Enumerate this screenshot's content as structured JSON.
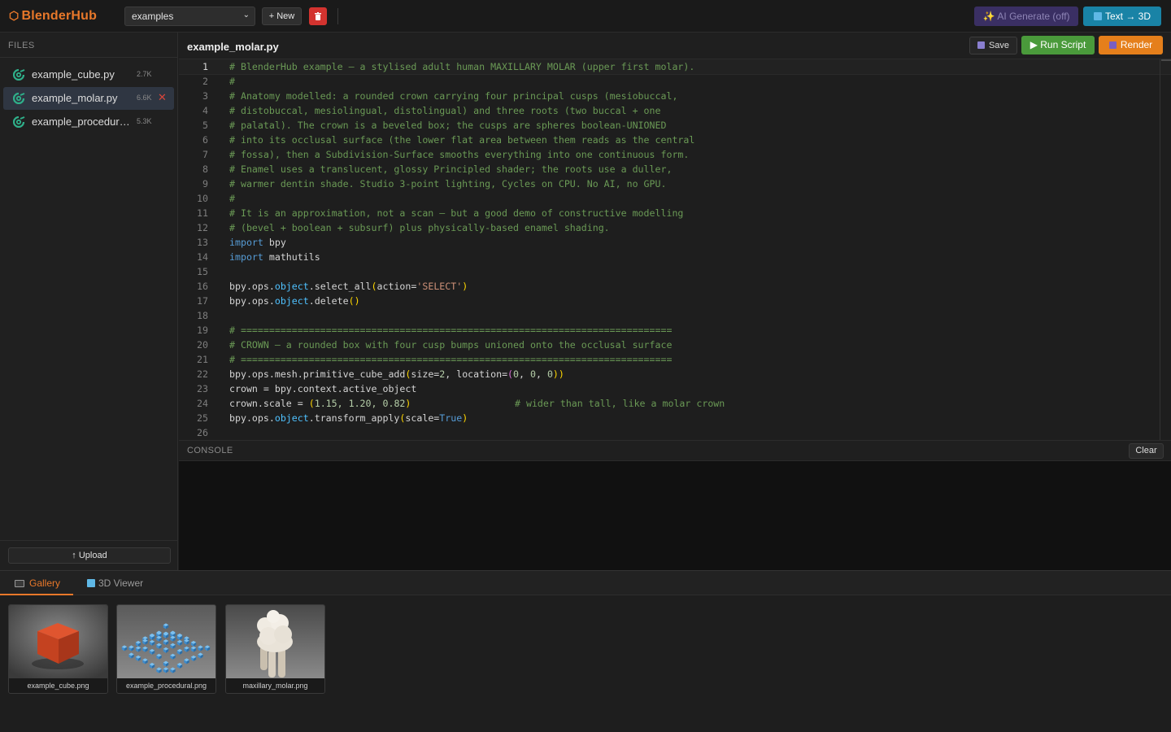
{
  "app": {
    "name": "BlenderHub",
    "project_select": "examples",
    "new_label": "+ New",
    "ai_generate_label": "AI Generate (off)",
    "text3d_label": "Text → 3D"
  },
  "sidebar": {
    "header": "FILES",
    "files": [
      {
        "name": "example_cube.py",
        "size": "2.7K"
      },
      {
        "name": "example_molar.py",
        "size": "6.6K"
      },
      {
        "name": "example_procedural.py",
        "size": "5.3K"
      }
    ],
    "upload_label": "↑ Upload"
  },
  "editor": {
    "filename": "example_molar.py",
    "save_label": "Save",
    "run_label": "▶ Run Script",
    "render_label": "Render",
    "line_numbers": [
      "1",
      "2",
      "3",
      "4",
      "5",
      "6",
      "7",
      "8",
      "9",
      "10",
      "11",
      "12",
      "13",
      "14",
      "15",
      "16",
      "17",
      "18",
      "19",
      "20",
      "21",
      "22",
      "23",
      "24",
      "25",
      "26"
    ],
    "code": {
      "l1": "# BlenderHub example — a stylised adult human MAXILLARY MOLAR (upper first molar).",
      "l2": "#",
      "l3": "# Anatomy modelled: a rounded crown carrying four principal cusps (mesiobuccal,",
      "l4": "# distobuccal, mesiolingual, distolingual) and three roots (two buccal + one",
      "l5": "# palatal). The crown is a beveled box; the cusps are spheres boolean-UNIONED",
      "l6": "# into its occlusal surface (the lower flat area between them reads as the central",
      "l7": "# fossa), then a Subdivision-Surface smooths everything into one continuous form.",
      "l8": "# Enamel uses a translucent, glossy Principled shader; the roots use a duller,",
      "l9": "# warmer dentin shade. Studio 3-point lighting, Cycles on CPU. No AI, no GPU.",
      "l10": "#",
      "l11": "# It is an approximation, not a scan — but a good demo of constructive modelling",
      "l12": "# (bevel + boolean + subsurf) plus physically-based enamel shading.",
      "l13_kw": "import",
      "l13": " bpy",
      "l14_kw": "import",
      "l14": " mathutils",
      "l16_a": "bpy.ops.",
      "l16_obj": "object",
      "l16_b": ".select_all",
      "l16_p1": "(",
      "l16_c": "action=",
      "l16_str": "'SELECT'",
      "l16_p2": ")",
      "l17_a": "bpy.ops.",
      "l17_obj": "object",
      "l17_b": ".delete",
      "l17_p": "()",
      "l19": "# ============================================================================",
      "l20": "# CROWN — a rounded box with four cusp bumps unioned onto the occlusal surface",
      "l21": "# ============================================================================",
      "l22_a": "bpy.ops.mesh.primitive_cube_add",
      "l22_p1": "(",
      "l22_b": "size=",
      "l22_n1": "2",
      "l22_c": ", location=",
      "l22_p2": "(",
      "l22_n2": "0",
      "l22_s1": ", ",
      "l22_n3": "0",
      "l22_s2": ", ",
      "l22_n4": "0",
      "l22_p3": "))",
      "l23": "crown = bpy.context.active_object",
      "l24_a": "crown.scale = ",
      "l24_p1": "(",
      "l24_n": "1.15, 1.20, 0.82",
      "l24_p2": ")",
      "l24_com": "# wider than tall, like a molar crown",
      "l25_a": "bpy.ops.",
      "l25_obj": "object",
      "l25_b": ".transform_apply",
      "l25_p1": "(",
      "l25_c": "scale=",
      "l25_bool": "True",
      "l25_p2": ")"
    }
  },
  "console": {
    "label": "CONSOLE",
    "clear_label": "Clear"
  },
  "bottom": {
    "tabs": {
      "gallery": "Gallery",
      "viewer": "3D Viewer"
    },
    "gallery": [
      {
        "caption": "example_cube.png"
      },
      {
        "caption": "example_procedural.png"
      },
      {
        "caption": "maxillary_molar.png"
      }
    ]
  },
  "colors": {
    "brand": "#e8782a",
    "run": "#4a9a3b",
    "render": "#e57f1b",
    "text3d": "#1983a6",
    "ai": "#3a2f63",
    "delete": "#d3332f"
  },
  "icons": [
    "hexagon-logo-icon",
    "trash-icon",
    "sparkle-icon",
    "cube-icon",
    "python-file-icon",
    "close-icon",
    "floppy-icon",
    "play-icon",
    "render-icon",
    "gallery-icon"
  ]
}
